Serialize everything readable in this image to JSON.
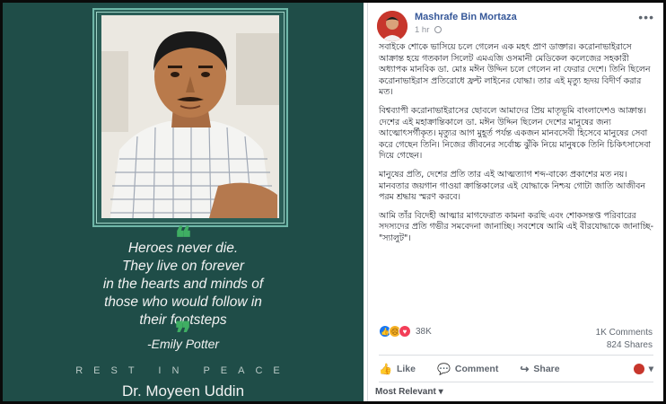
{
  "memorial": {
    "quote_lines": [
      "Heroes never die.",
      "They live on forever",
      "in the hearts and minds of",
      "those who would follow in",
      "their footsteps"
    ],
    "author": "-Emily Potter",
    "rip": "REST IN PEACE",
    "name": "Dr. Moyeen Uddin",
    "quote_open": "❝",
    "quote_close": "❞",
    "accent_color": "#3fae63",
    "background_color": "#1f4d48"
  },
  "post": {
    "author_name": "Mashrafe Bin Mortaza",
    "time": "1 hr",
    "more_icon": "more-options-icon",
    "paragraphs": [
      "সবাইকে শোকে ভাসিয়ে চলে গেলেন এক মহৎ প্রাণ ডাক্তার। করোনাভাইরাসে আক্রান্ত হয়ে গতকাল সিলেট এমএজি ওসমানী মেডিকেল কলেজের সহকারী অধ্যাপক মানবিক ডা. মোঃ মঈন উদ্দিন চলে গেলেন না ফেরার দেশে। তিনি ছিলেন করোনাভাইরাস প্রতিরোধে ফ্রন্ট লাইনের যোদ্ধা। তার এই মৃত্যু হৃদয় বিদীর্ণ করার মত।",
      "বিশ্বব্যাপী করোনাভাইরাসের ছোবলে আমাদের প্রিয় মাতৃভূমি বাংলাদেশও আক্রান্ত। দেশের এই মহাক্রান্তিকালে ডা. মঈন উদ্দিন ছিলেন দেশের মানুষের জন্য আত্মোৎসর্গীকৃত। মৃত্যুর আগ মুহূর্ত পর্যন্ত একজন মানবসেবী হিসেবে মানুষের সেবা করে গেছেন তিনি। নিজের জীবনের সর্বোচ্চ ঝুঁকি নিয়ে মানুষকে তিনি চিকিৎসাসেবা দিয়ে গেছেন।",
      "মানুষের প্রতি, দেশের প্রতি তার এই আত্মত্যাগ শব্দ-বাক্যে প্রকাশের মত নয়। মানবতার জয়গান গাওয়া ক্রান্তিকালের এই যোদ্ধাকে নিশ্চয় গোটা জাতি আজীবন পরম শ্রদ্ধায় স্মরণ করবে।",
      "আমি তাঁর বিদেহী আত্মার মাগফেরাত কামনা করছি এবং শোকসন্তপ্ত পরিবারের সদস্যদের প্রতি গভীর সমবেদনা জানাচ্ছি। সবশেষে আমি এই বীরযোদ্ধাকে জানাচ্ছি- \"স্যালুট\"।"
    ],
    "reaction_count": "38K",
    "comments": "1K Comments",
    "shares": "824 Shares",
    "actions": {
      "like": "Like",
      "comment": "Comment",
      "share": "Share"
    },
    "most_relevant": "Most Relevant ▾",
    "link_color": "#365899"
  }
}
